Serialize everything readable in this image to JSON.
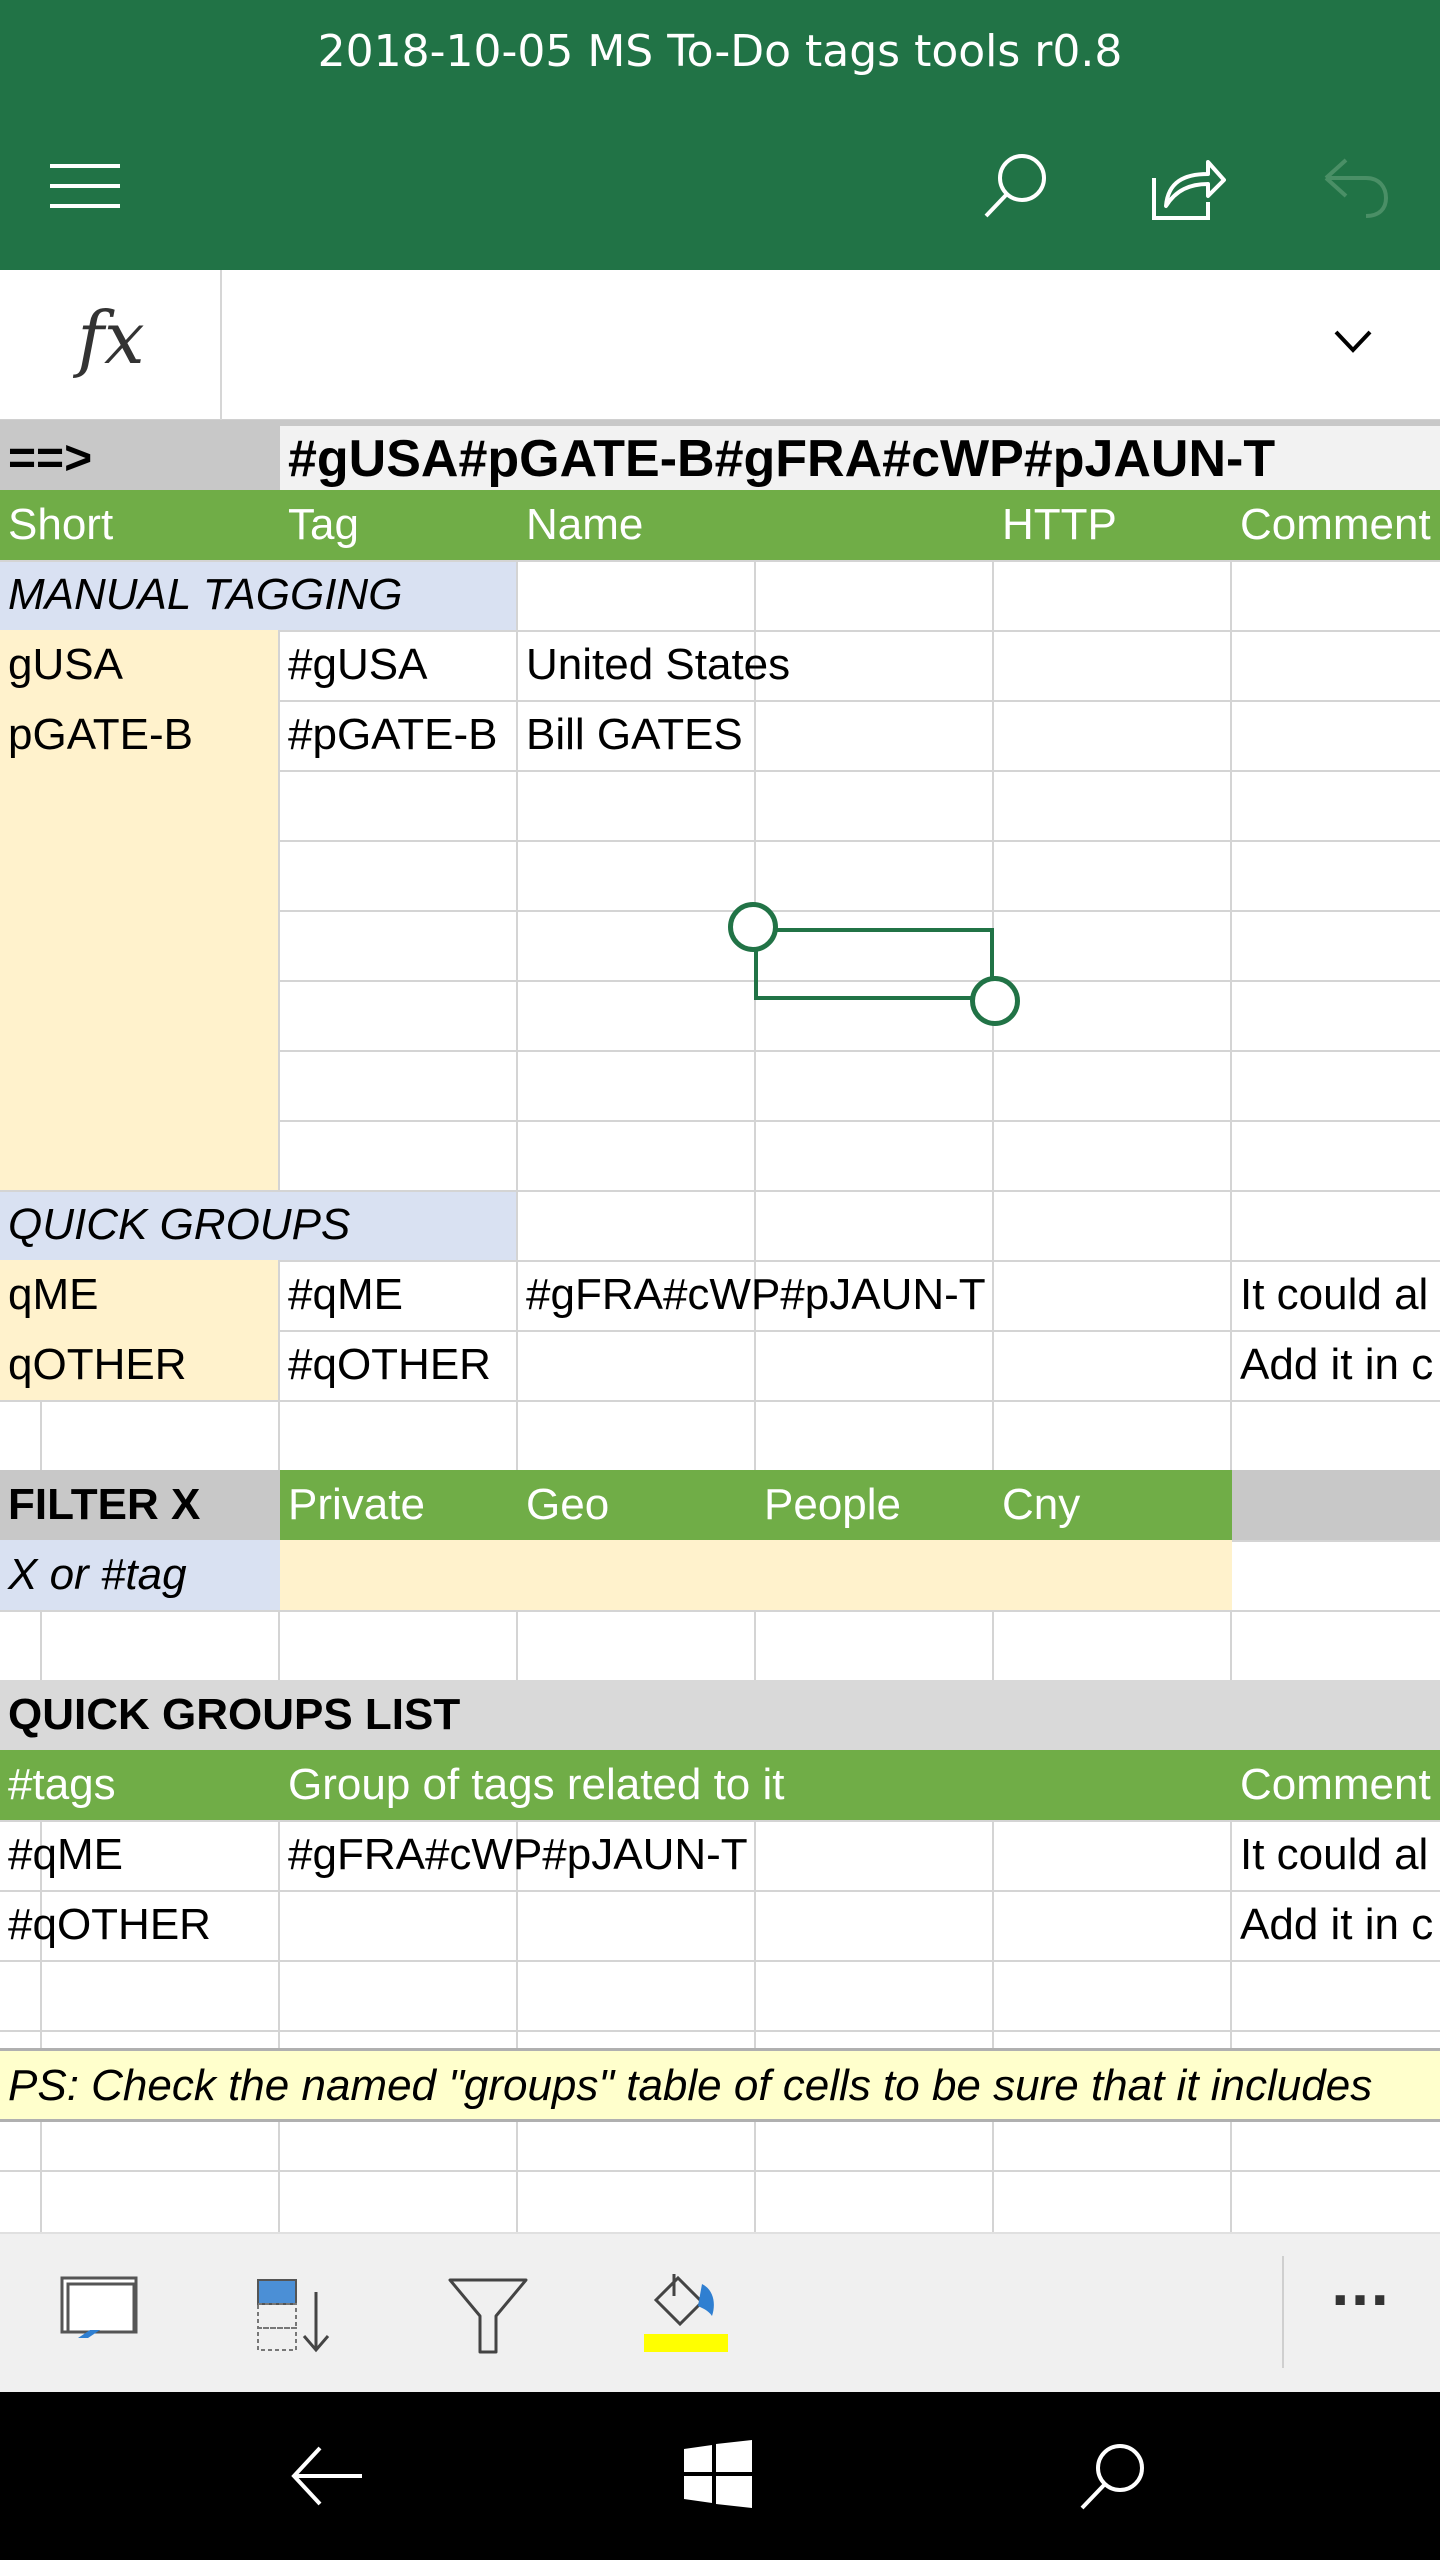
{
  "window": {
    "title": "2018-10-05 MS To-Do tags tools r0.8"
  },
  "command_bar": {
    "menu_icon": "hamburger-icon",
    "search_icon": "search-icon",
    "share_icon": "share-icon",
    "undo_icon": "undo-icon"
  },
  "formula_bar": {
    "fx_label": "fx",
    "value": "",
    "expand_icon": "chevron-down-icon"
  },
  "sheet": {
    "arrow_label": "==>",
    "result": "#gUSA#pGATE-B#gFRA#cWP#pJAUN-T",
    "headers": {
      "short": "Short",
      "tag": "Tag",
      "name": "Name",
      "http": "HTTP",
      "comment": "Comment"
    },
    "manual_tagging_label": "MANUAL TAGGING",
    "manual_rows": [
      {
        "short": "gUSA",
        "tag": "#gUSA",
        "name": "United States"
      },
      {
        "short": "pGATE-B",
        "tag": "#pGATE-B",
        "name": "Bill GATES"
      }
    ],
    "quick_groups_label": "QUICK GROUPS",
    "quick_rows": [
      {
        "short": "qME",
        "tag": "#qME",
        "name": "#gFRA#cWP#pJAUN-T",
        "comment": "It could al"
      },
      {
        "short": "qOTHER",
        "tag": "#qOTHER",
        "name": "",
        "comment": "Add it in c"
      }
    ],
    "filter": {
      "label": "FILTER X",
      "columns": [
        "Private",
        "Geo",
        "People",
        "Cny"
      ],
      "input_label": "X or #tag"
    },
    "quick_groups_list": {
      "title": "QUICK GROUPS LIST",
      "headers": {
        "tags": "#tags",
        "group": "Group of tags related to it",
        "comment": "Comment"
      },
      "rows": [
        {
          "tags": "#qME",
          "group": "#gFRA#cWP#pJAUN-T",
          "comment": "It could al"
        },
        {
          "tags": "#qOTHER",
          "group": "",
          "comment": "Add it in c"
        }
      ]
    },
    "ps_note": "PS: Check the named \"groups\" table of cells to be sure that it includes"
  },
  "bottom_toolbar": {
    "items": [
      "freeze-panes-icon",
      "sort-icon",
      "filter-icon",
      "fill-color-icon",
      "more-icon"
    ],
    "more_label": "...",
    "fill_color": "#ffff00"
  },
  "colors": {
    "excel_green": "#217346",
    "header_green": "#70ad47",
    "tan": "#fff2cc",
    "lavender": "#d9e1f2",
    "gray": "#c8c8c8"
  },
  "nav": {
    "back_icon": "back-arrow-icon",
    "windows_icon": "windows-logo-icon",
    "search_icon": "search-icon"
  }
}
